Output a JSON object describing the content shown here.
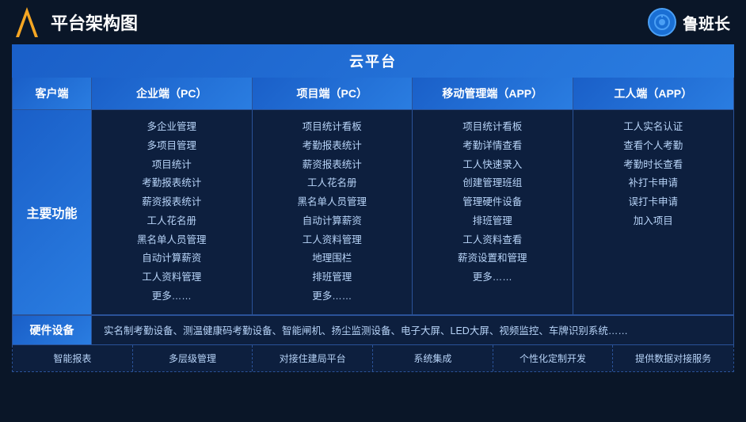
{
  "header": {
    "title": "平台架构图",
    "brand": "鲁班长"
  },
  "cloud_platform": {
    "label": "云平台"
  },
  "columns": [
    {
      "id": "client",
      "label": "客户端"
    },
    {
      "id": "enterprise",
      "label": "企业端（PC）"
    },
    {
      "id": "project",
      "label": "项目端（PC）"
    },
    {
      "id": "mobile",
      "label": "移动管理端（APP）"
    },
    {
      "id": "worker",
      "label": "工人端（APP）"
    }
  ],
  "main_function_label": "主要功能",
  "features": {
    "enterprise": [
      "多企业管理",
      "多项目管理",
      "项目统计",
      "考勤报表统计",
      "薪资报表统计",
      "工人花名册",
      "黑名单人员管理",
      "自动计算薪资",
      "工人资料管理",
      "更多……"
    ],
    "project": [
      "项目统计看板",
      "考勤报表统计",
      "薪资报表统计",
      "工人花名册",
      "黑名单人员管理",
      "自动计算薪资",
      "工人资料管理",
      "地理围栏",
      "排班管理",
      "更多……"
    ],
    "mobile": [
      "项目统计看板",
      "考勤详情查看",
      "工人快速录入",
      "创建管理班组",
      "管理硬件设备",
      "排班管理",
      "工人资料查看",
      "薪资设置和管理",
      "更多……"
    ],
    "worker": [
      "工人实名认证",
      "查看个人考勤",
      "考勤时长查看",
      "补打卡申请",
      "误打卡申请",
      "加入项目"
    ]
  },
  "hardware": {
    "label": "硬件设备",
    "content": "实名制考勤设备、测温健康码考勤设备、智能闸机、扬尘监测设备、电子大屏、LED大屏、视频监控、车牌识别系统……"
  },
  "bottom_items": [
    "智能报表",
    "多层级管理",
    "对接住建局平台",
    "系统集成",
    "个性化定制开发",
    "提供数据对接服务"
  ]
}
